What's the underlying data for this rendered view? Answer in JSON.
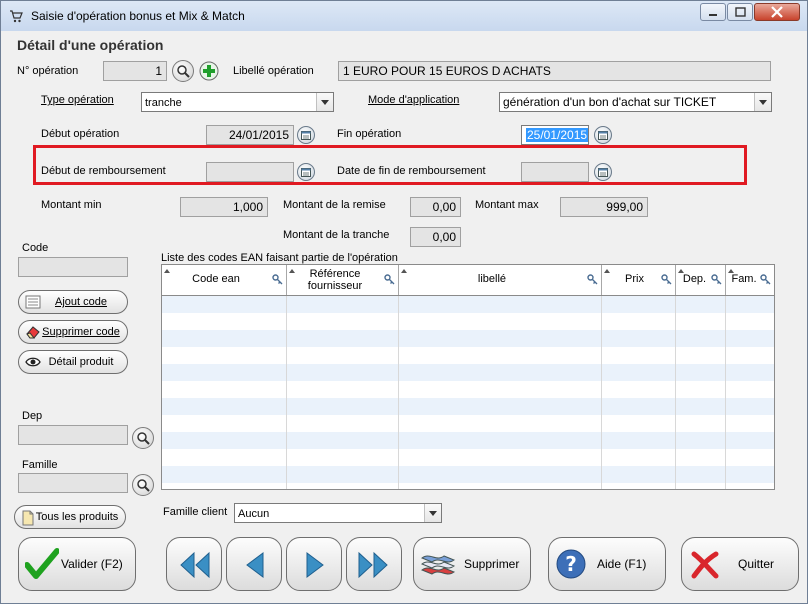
{
  "window": {
    "title": "Saisie d'opération bonus et Mix & Match"
  },
  "section_title": "Détail d'une opération",
  "operation": {
    "number_label": "N° opération",
    "number_value": "1",
    "libelle_label": "Libellé opération",
    "libelle_value": "1 EURO POUR 15 EUROS D ACHATS"
  },
  "type": {
    "label": "Type opération",
    "value": "tranche"
  },
  "mode": {
    "label": "Mode d'application",
    "value": "génération d'un bon d'achat sur TICKET"
  },
  "dates": {
    "start_label": "Début opération",
    "start_value": "24/01/2015",
    "end_label": "Fin opération",
    "end_value": "25/01/2015",
    "refund_start_label": "Début de remboursement",
    "refund_start_value": "",
    "refund_end_label": "Date de fin de remboursement",
    "refund_end_value": ""
  },
  "amounts": {
    "min_label": "Montant min",
    "min_value": "1,000",
    "remise_label": "Montant de la remise",
    "remise_value": "0,00",
    "max_label": "Montant max",
    "max_value": "999,00",
    "tranche_label": "Montant de la tranche",
    "tranche_value": "0,00"
  },
  "code": {
    "label": "Code",
    "value": ""
  },
  "actions": {
    "add_code": "Ajout code",
    "delete_code": "Supprimer code",
    "product_detail": "Détail produit",
    "all_products": "Tous les produits"
  },
  "dep": {
    "label": "Dep",
    "value": ""
  },
  "famille": {
    "label": "Famille",
    "value": ""
  },
  "ean_list": {
    "caption": "Liste des codes EAN faisant partie de l'opération",
    "columns": [
      {
        "label": "Code ean"
      },
      {
        "label": "Référence fournisseur"
      },
      {
        "label": "libellé"
      },
      {
        "label": "Prix"
      },
      {
        "label": "Dep."
      },
      {
        "label": "Fam."
      }
    ],
    "rows": []
  },
  "famille_client": {
    "label": "Famille client",
    "value": "Aucun"
  },
  "footer": {
    "validate": "Valider (F2)",
    "delete": "Supprimer",
    "help": "Aide (F1)",
    "quit": "Quitter"
  },
  "colors": {
    "highlight_border": "#e01a22",
    "selection": "#3399ff",
    "row_alt": "#eaf2fb"
  },
  "icons": [
    "cart-icon",
    "magnifier-icon",
    "plus-icon",
    "calendar-icon",
    "checkmark-icon",
    "first-icon",
    "previous-icon",
    "next-icon",
    "last-icon",
    "flag-icon",
    "help-icon",
    "quit-icon",
    "eye-icon",
    "eraser-icon",
    "list-icon",
    "document-icon",
    "key-icon"
  ]
}
